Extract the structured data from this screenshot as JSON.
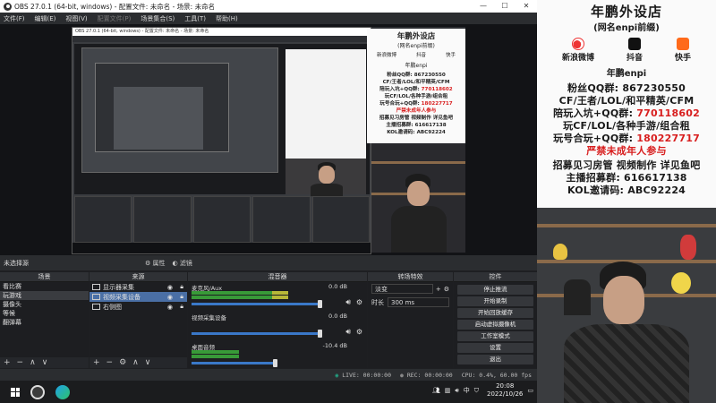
{
  "window": {
    "title": "OBS 27.0.1 (64-bit, windows) - 配置文件: 未命名 - 场景: 未命名",
    "minimize": "—",
    "maximize": "☐",
    "close": "✕"
  },
  "menu": [
    {
      "label": "文件(F)",
      "enabled": true
    },
    {
      "label": "编辑(E)",
      "enabled": true
    },
    {
      "label": "视图(V)",
      "enabled": true
    },
    {
      "label": "配置文件(P)",
      "enabled": false
    },
    {
      "label": "场景集合(S)",
      "enabled": true
    },
    {
      "label": "工具(T)",
      "enabled": true
    },
    {
      "label": "帮助(H)",
      "enabled": true
    }
  ],
  "nested": {
    "title": "OBS 27.0.1 (64-bit, windows) - 配置文件: 未命名 - 场景: 未命名"
  },
  "overlay_card": {
    "title": "年鹏外设店",
    "subtitle": "(网名enpi前缀)",
    "platforms": [
      "新浪微博",
      "抖音",
      "快手"
    ],
    "name": "年鹏enpi",
    "lines": [
      {
        "prefix": "粉丝QQ群: ",
        "value": "867230550",
        "highlight": false
      },
      {
        "prefix": "CF/王者/LOL/和平精英/CFM",
        "value": "",
        "highlight": false
      },
      {
        "prefix": "陪玩入坑+QQ群: ",
        "value": "770118602",
        "highlight": true
      },
      {
        "prefix": "玩CF/LOL/各种手游/组合租",
        "value": "",
        "highlight": false
      },
      {
        "prefix": "玩号合玩+QQ群: ",
        "value": "180227717",
        "highlight": true
      },
      {
        "prefix": "严禁未成年人参与",
        "value": "",
        "highlight": true
      },
      {
        "prefix": "招募见习房管 视频制作 详见鱼吧",
        "value": "",
        "highlight": false
      },
      {
        "prefix": "主播招募群: ",
        "value": "616617138",
        "highlight": false
      },
      {
        "prefix": "KOL邀请码: ",
        "value": "ABC92224",
        "highlight": false
      }
    ]
  },
  "scene_bar": {
    "no_source": "未选择源",
    "properties": "属性",
    "filters": "滤镜"
  },
  "scenes": {
    "header": "场景",
    "items": [
      "看比赛",
      "玩游戏",
      "摄像头",
      "等候",
      "翻弹幕"
    ],
    "selected": 1
  },
  "sources": {
    "header": "来源",
    "items": [
      "显示器采集",
      "视频采集设备",
      "右侧图"
    ],
    "selected": 1
  },
  "mixer": {
    "header": "混音器",
    "channels": [
      {
        "name": "麦克风/Aux",
        "db": "0.0 dB",
        "level": 0.72,
        "volume": 0.95
      },
      {
        "name": "视频采集设备",
        "db": "0.0 dB",
        "level": 0.0,
        "volume": 0.95
      },
      {
        "name": "桌面音频",
        "db": "-10.4 dB",
        "level": 0.35,
        "volume": 0.62
      }
    ]
  },
  "transitions": {
    "header": "转场特效",
    "type": "淡变",
    "duration_label": "时长",
    "duration": "300 ms"
  },
  "controls": {
    "header": "控件",
    "buttons": [
      "停止推流",
      "开始录制",
      "开始回放缓存",
      "启动虚拟摄像机",
      "工作室模式",
      "设置",
      "退出"
    ]
  },
  "status": {
    "live": "LIVE: 00:00:00",
    "rec": "REC: 00:00:00",
    "cpu": "CPU: 0.4%, 60.00 fps"
  },
  "taskbar": {
    "tray_lang": "中",
    "time": "20:08",
    "date": "2022/10/26"
  }
}
